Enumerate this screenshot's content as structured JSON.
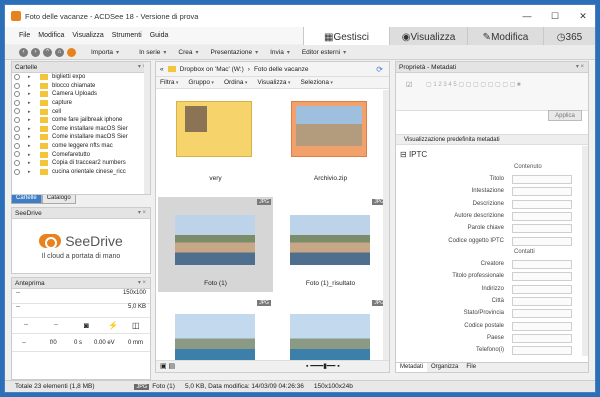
{
  "window": {
    "title": "Foto delle vacanze - ACDSee 18 - Versione di prova",
    "min": "—",
    "max": "☐",
    "close": "✕"
  },
  "menu": [
    "File",
    "Modifica",
    "Visualizza",
    "Strumenti",
    "Guida"
  ],
  "modes": {
    "gestisci": "Gestisci",
    "visualizza": "Visualizza",
    "modifica": "Modifica",
    "n365": "365"
  },
  "toolbar": {
    "importa": "Importa",
    "in_serie": "In serie",
    "crea": "Crea",
    "presentazione": "Presentazione",
    "invia": "Invia",
    "editor": "Editor esterni"
  },
  "folders": {
    "title": "Cartelle",
    "items": [
      "biglietti expo",
      "blocco chiamate",
      "Camera Uploads",
      "capture",
      "cell",
      "come fare jailbreak iphone",
      "Come installare macOS Sier",
      "Come installare macOS Sier",
      "come leggere nfts mac",
      "Comefaretutto",
      "Copia di traccear2 numbers",
      "cucina orientale cinese_ricc"
    ],
    "tab_cartelle": "Cartelle",
    "tab_catalogo": "Catalogo"
  },
  "seedrive": {
    "title": "SeeDrive",
    "name": "SeeDrive",
    "tagline": "Il cloud a portata di mano"
  },
  "preview": {
    "title": "Anteprima",
    "dims": "150x100",
    "size": "5,0 KB",
    "dash": "--",
    "f": "f/0",
    "s": "0 s",
    "ev": "0.00 eV",
    "mm": "0 mm"
  },
  "browser": {
    "path": [
      "Dropbox on 'Mac' (W:)",
      "Foto delle vacanze"
    ],
    "filters": [
      "Filtra",
      "Gruppo",
      "Ordina",
      "Visualizza",
      "Seleziona"
    ],
    "jpg": "JPG",
    "thumbs": [
      "very",
      "Archivio.zip",
      "Foto (1)",
      "Foto (1)_risultato",
      "",
      ""
    ]
  },
  "properties": {
    "title": "Proprietà - Metadati",
    "applica": "Applica",
    "viz": "Visualizzazione predefinita metadati",
    "iptc": "IPTC",
    "contenuto": "Contenuto",
    "contatti": "Contatti",
    "fields_a": [
      "Titolo",
      "Intestazione",
      "Descrizione",
      "Autore descrizione",
      "Parole chiave",
      "Codice oggetto IPTC"
    ],
    "fields_b": [
      "Creatore",
      "Titolo professionale",
      "Indirizzo",
      "Città",
      "Stato/Provincia",
      "Codice postale",
      "Paese",
      "Telefono(i)"
    ],
    "tabs": [
      "Metadati",
      "Organizza",
      "File"
    ]
  },
  "status": {
    "total": "Totale 23 elementi (1,8 MB)",
    "badge": "JPG",
    "name": "Foto (1)",
    "info": "5,0 KB, Data modifica: 14/03/09 04:26:36",
    "dims": "150x100x24b"
  }
}
